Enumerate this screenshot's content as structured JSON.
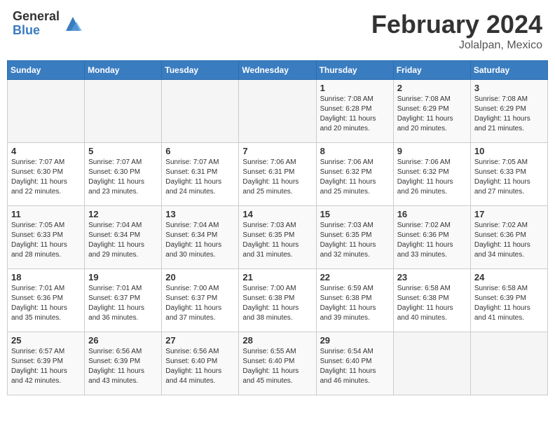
{
  "header": {
    "logo_general": "General",
    "logo_blue": "Blue",
    "month_year": "February 2024",
    "location": "Jolalpan, Mexico"
  },
  "calendar": {
    "days_of_week": [
      "Sunday",
      "Monday",
      "Tuesday",
      "Wednesday",
      "Thursday",
      "Friday",
      "Saturday"
    ],
    "weeks": [
      [
        {
          "day": "",
          "info": ""
        },
        {
          "day": "",
          "info": ""
        },
        {
          "day": "",
          "info": ""
        },
        {
          "day": "",
          "info": ""
        },
        {
          "day": "1",
          "info": "Sunrise: 7:08 AM\nSunset: 6:28 PM\nDaylight: 11 hours\nand 20 minutes."
        },
        {
          "day": "2",
          "info": "Sunrise: 7:08 AM\nSunset: 6:29 PM\nDaylight: 11 hours\nand 20 minutes."
        },
        {
          "day": "3",
          "info": "Sunrise: 7:08 AM\nSunset: 6:29 PM\nDaylight: 11 hours\nand 21 minutes."
        }
      ],
      [
        {
          "day": "4",
          "info": "Sunrise: 7:07 AM\nSunset: 6:30 PM\nDaylight: 11 hours\nand 22 minutes."
        },
        {
          "day": "5",
          "info": "Sunrise: 7:07 AM\nSunset: 6:30 PM\nDaylight: 11 hours\nand 23 minutes."
        },
        {
          "day": "6",
          "info": "Sunrise: 7:07 AM\nSunset: 6:31 PM\nDaylight: 11 hours\nand 24 minutes."
        },
        {
          "day": "7",
          "info": "Sunrise: 7:06 AM\nSunset: 6:31 PM\nDaylight: 11 hours\nand 25 minutes."
        },
        {
          "day": "8",
          "info": "Sunrise: 7:06 AM\nSunset: 6:32 PM\nDaylight: 11 hours\nand 25 minutes."
        },
        {
          "day": "9",
          "info": "Sunrise: 7:06 AM\nSunset: 6:32 PM\nDaylight: 11 hours\nand 26 minutes."
        },
        {
          "day": "10",
          "info": "Sunrise: 7:05 AM\nSunset: 6:33 PM\nDaylight: 11 hours\nand 27 minutes."
        }
      ],
      [
        {
          "day": "11",
          "info": "Sunrise: 7:05 AM\nSunset: 6:33 PM\nDaylight: 11 hours\nand 28 minutes."
        },
        {
          "day": "12",
          "info": "Sunrise: 7:04 AM\nSunset: 6:34 PM\nDaylight: 11 hours\nand 29 minutes."
        },
        {
          "day": "13",
          "info": "Sunrise: 7:04 AM\nSunset: 6:34 PM\nDaylight: 11 hours\nand 30 minutes."
        },
        {
          "day": "14",
          "info": "Sunrise: 7:03 AM\nSunset: 6:35 PM\nDaylight: 11 hours\nand 31 minutes."
        },
        {
          "day": "15",
          "info": "Sunrise: 7:03 AM\nSunset: 6:35 PM\nDaylight: 11 hours\nand 32 minutes."
        },
        {
          "day": "16",
          "info": "Sunrise: 7:02 AM\nSunset: 6:36 PM\nDaylight: 11 hours\nand 33 minutes."
        },
        {
          "day": "17",
          "info": "Sunrise: 7:02 AM\nSunset: 6:36 PM\nDaylight: 11 hours\nand 34 minutes."
        }
      ],
      [
        {
          "day": "18",
          "info": "Sunrise: 7:01 AM\nSunset: 6:36 PM\nDaylight: 11 hours\nand 35 minutes."
        },
        {
          "day": "19",
          "info": "Sunrise: 7:01 AM\nSunset: 6:37 PM\nDaylight: 11 hours\nand 36 minutes."
        },
        {
          "day": "20",
          "info": "Sunrise: 7:00 AM\nSunset: 6:37 PM\nDaylight: 11 hours\nand 37 minutes."
        },
        {
          "day": "21",
          "info": "Sunrise: 7:00 AM\nSunset: 6:38 PM\nDaylight: 11 hours\nand 38 minutes."
        },
        {
          "day": "22",
          "info": "Sunrise: 6:59 AM\nSunset: 6:38 PM\nDaylight: 11 hours\nand 39 minutes."
        },
        {
          "day": "23",
          "info": "Sunrise: 6:58 AM\nSunset: 6:38 PM\nDaylight: 11 hours\nand 40 minutes."
        },
        {
          "day": "24",
          "info": "Sunrise: 6:58 AM\nSunset: 6:39 PM\nDaylight: 11 hours\nand 41 minutes."
        }
      ],
      [
        {
          "day": "25",
          "info": "Sunrise: 6:57 AM\nSunset: 6:39 PM\nDaylight: 11 hours\nand 42 minutes."
        },
        {
          "day": "26",
          "info": "Sunrise: 6:56 AM\nSunset: 6:39 PM\nDaylight: 11 hours\nand 43 minutes."
        },
        {
          "day": "27",
          "info": "Sunrise: 6:56 AM\nSunset: 6:40 PM\nDaylight: 11 hours\nand 44 minutes."
        },
        {
          "day": "28",
          "info": "Sunrise: 6:55 AM\nSunset: 6:40 PM\nDaylight: 11 hours\nand 45 minutes."
        },
        {
          "day": "29",
          "info": "Sunrise: 6:54 AM\nSunset: 6:40 PM\nDaylight: 11 hours\nand 46 minutes."
        },
        {
          "day": "",
          "info": ""
        },
        {
          "day": "",
          "info": ""
        }
      ]
    ]
  }
}
